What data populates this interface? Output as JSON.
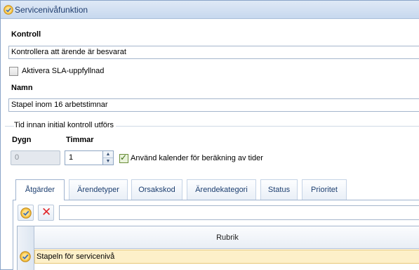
{
  "window": {
    "title": "Servicenivåfunktion",
    "icon": "badge-check-icon"
  },
  "form": {
    "kontroll_label": "Kontroll",
    "kontroll_value": "Kontrollera att ärende är besvarat",
    "sla_checkbox": {
      "label": "Aktivera SLA-uppfyllnad",
      "checked": false
    },
    "namn_label": "Namn",
    "namn_value": "Stapel inom 16 arbetstimnar",
    "time_group_label": "Tid innan initial kontroll utförs",
    "dygn_label": "Dygn",
    "dygn_value": "0",
    "timmar_label": "Timmar",
    "timmar_value": "1",
    "calendar_checkbox": {
      "label": "Använd kalender för beräkning av tider",
      "checked": true
    }
  },
  "tabs": [
    "Åtgärder",
    "Ärendetyper",
    "Orsakskod",
    "Ärendekategori",
    "Status",
    "Prioritet"
  ],
  "active_tab": "Åtgärder",
  "toolbar": {
    "add_icon": "badge-check-icon",
    "delete_icon": "close-icon"
  },
  "grid": {
    "column_header": "Rubrik",
    "rows": [
      {
        "label": "Stapeln för servicenivå",
        "icon": "badge-check-icon"
      }
    ]
  },
  "colors": {
    "accent": "#1e3c6e",
    "selected_row": "#fdf0c9",
    "delete": "#e0262a"
  }
}
